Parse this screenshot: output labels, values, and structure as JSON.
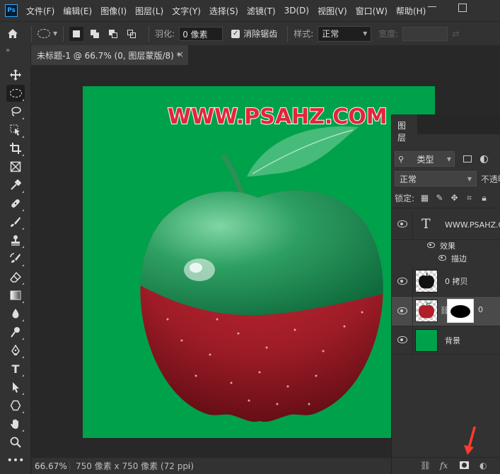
{
  "app": {
    "logo": "Ps"
  },
  "menubar": {
    "items": [
      "文件(F)",
      "编辑(E)",
      "图像(I)",
      "图层(L)",
      "文字(Y)",
      "选择(S)",
      "滤镜(T)",
      "3D(D)",
      "视图(V)",
      "窗口(W)",
      "帮助(H)"
    ]
  },
  "options": {
    "feather_label": "羽化:",
    "feather_value": "0 像素",
    "antialias_label": "消除锯齿",
    "style_label": "样式:",
    "style_value": "正常",
    "width_label": "宽度:"
  },
  "document": {
    "tab_title": "未标题-1 @ 66.7% (0, 图层蒙版/8) *",
    "watermark_text": "WWW.PSAHZ.COM"
  },
  "status": {
    "zoom": "66.67%",
    "info": "750 像素 x 750 像素 (72 ppi)"
  },
  "layers_panel": {
    "tab": "图层",
    "filter_label": "类型",
    "blend_mode": "正常",
    "opacity_label": "不透明",
    "lock_label": "锁定:",
    "layers": [
      {
        "name": "WWW.PSAHZ.COM",
        "type": "text",
        "effects_label": "效果",
        "effect_item": "描边"
      },
      {
        "name": "0 拷贝",
        "type": "image"
      },
      {
        "name": "0",
        "type": "masked",
        "selected": true
      },
      {
        "name": "背景",
        "type": "fill"
      }
    ]
  },
  "colors": {
    "canvas_bg": "#00a14b",
    "watermark_fill": "#e2263a",
    "accent_arrow": "#ff3b30"
  },
  "icons": {
    "toolbar": [
      "move-icon",
      "elliptical-marquee-icon",
      "lasso-icon",
      "object-select-icon",
      "crop-icon",
      "frame-icon",
      "eyedropper-icon",
      "healing-brush-icon",
      "brush-icon",
      "clone-stamp-icon",
      "history-brush-icon",
      "eraser-icon",
      "gradient-icon",
      "blur-icon",
      "dodge-icon",
      "pen-icon",
      "type-icon",
      "path-select-icon",
      "shape-icon",
      "hand-icon",
      "zoom-icon",
      "more-tools-icon"
    ]
  }
}
